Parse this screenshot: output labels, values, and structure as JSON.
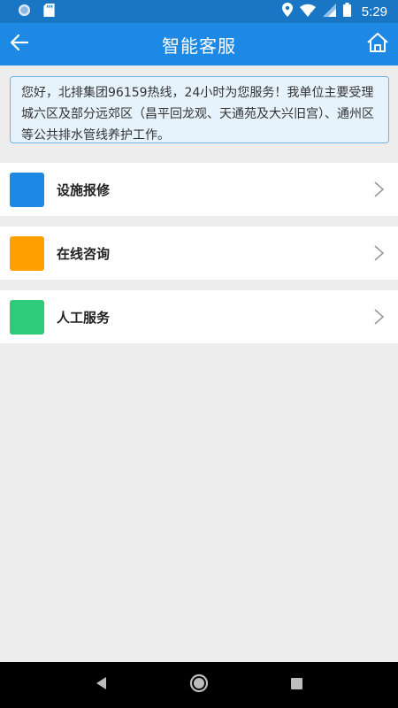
{
  "status_bar": {
    "time": "5:29",
    "icons": [
      "record-icon",
      "sd-card-icon",
      "location-icon",
      "wifi-icon",
      "cellular-signal-icon",
      "battery-icon"
    ]
  },
  "app_bar": {
    "title": "智能客服",
    "back_icon": "arrow-left-icon",
    "home_icon": "home-icon",
    "background": "#1e88e5"
  },
  "notice": {
    "text": "您好，北排集团96159热线，24小时为您服务！我单位主要受理城六区及部分远郊区（昌平回龙观、天通苑及大兴旧宫）、通州区等公共排水管线养护工作。"
  },
  "menu": {
    "items": [
      {
        "label": "设施报修",
        "color": "#1e88e5",
        "chevron": "chevron-right-icon"
      },
      {
        "label": "在线咨询",
        "color": "#ffa000",
        "chevron": "chevron-right-icon"
      },
      {
        "label": "人工服务",
        "color": "#2ecc7a",
        "chevron": "chevron-right-icon"
      }
    ]
  },
  "nav_bar": {
    "buttons": [
      "back-triangle-icon",
      "home-circle-icon",
      "recents-square-icon"
    ]
  }
}
